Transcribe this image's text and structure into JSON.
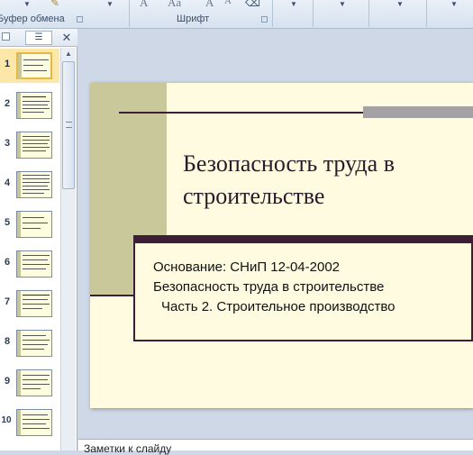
{
  "ribbon": {
    "clipboard_label": "Буфер обмена",
    "font_label": "Шрифт",
    "font_increase": "A",
    "change_case": "Aa",
    "grow_font": "A",
    "shrink_font": "A"
  },
  "panel": {
    "outline_tab": "☰",
    "close": "✕",
    "slides": [
      {
        "num": "1",
        "selected": true
      },
      {
        "num": "2"
      },
      {
        "num": "3"
      },
      {
        "num": "4"
      },
      {
        "num": "5"
      },
      {
        "num": "6"
      },
      {
        "num": "7"
      },
      {
        "num": "8"
      },
      {
        "num": "9"
      },
      {
        "num": "10"
      }
    ]
  },
  "slide": {
    "title_line1": "Безопасность труда в",
    "title_line2": "строительстве",
    "body_line1": "Основание: СНиП 12-04-2002",
    "body_line2": "Безопасность труда в строительстве",
    "body_line3": "Часть 2. Строительное производство"
  },
  "notes": {
    "text": "Заметки к слайду"
  },
  "colors": {
    "accent_dark": "#3c1e37",
    "olive": "#c8c89b",
    "slide_bg": "#fffbe0",
    "selection": "#fbe7a8"
  }
}
